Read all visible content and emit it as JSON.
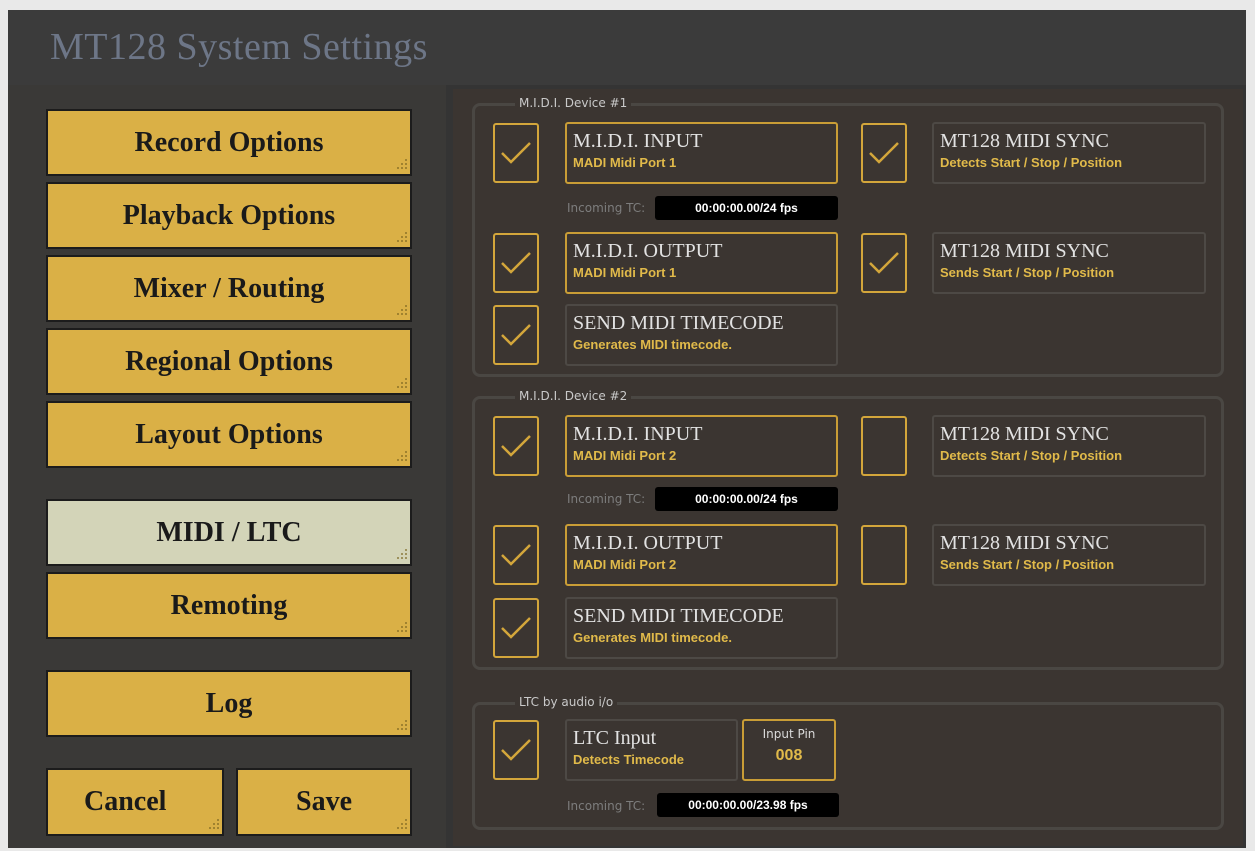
{
  "window": {
    "title": "MT128 System Settings"
  },
  "nav": {
    "items": [
      {
        "label": "Record Options",
        "active": false
      },
      {
        "label": "Playback Options",
        "active": false
      },
      {
        "label": "Mixer / Routing",
        "active": false
      },
      {
        "label": "Regional Options",
        "active": false
      },
      {
        "label": "Layout Options",
        "active": false
      },
      {
        "label": "MIDI / LTC",
        "active": true
      },
      {
        "label": "Remoting",
        "active": false
      },
      {
        "label": "Log",
        "active": false
      }
    ],
    "cancel_label": "Cancel",
    "save_label": "Save"
  },
  "device1": {
    "legend": "M.I.D.I. Device #1",
    "input": {
      "title": "M.I.D.I. INPUT",
      "subtitle": "MADI Midi Port 1",
      "checked": true
    },
    "input_sync": {
      "title": "MT128 MIDI SYNC",
      "subtitle": "Detects Start / Stop / Position",
      "checked": true
    },
    "incoming_tc_label": "Incoming TC:",
    "incoming_tc": "00:00:00.00/24 fps",
    "output": {
      "title": "M.I.D.I. OUTPUT",
      "subtitle": "MADI Midi Port 1",
      "checked": true
    },
    "output_sync": {
      "title": "MT128 MIDI SYNC",
      "subtitle": "Sends Start / Stop / Position",
      "checked": true
    },
    "send_tc": {
      "title": "SEND MIDI TIMECODE",
      "subtitle": "Generates MIDI timecode.",
      "checked": true
    }
  },
  "device2": {
    "legend": "M.I.D.I. Device #2",
    "input": {
      "title": "M.I.D.I. INPUT",
      "subtitle": "MADI Midi Port 2",
      "checked": true
    },
    "input_sync": {
      "title": "MT128 MIDI SYNC",
      "subtitle": "Detects Start / Stop / Position",
      "checked": false
    },
    "incoming_tc_label": "Incoming TC:",
    "incoming_tc": "00:00:00.00/24 fps",
    "output": {
      "title": "M.I.D.I. OUTPUT",
      "subtitle": "MADI Midi Port 2",
      "checked": true
    },
    "output_sync": {
      "title": "MT128 MIDI SYNC",
      "subtitle": "Sends Start / Stop / Position",
      "checked": false
    },
    "send_tc": {
      "title": "SEND MIDI TIMECODE",
      "subtitle": "Generates MIDI timecode.",
      "checked": true
    }
  },
  "ltc": {
    "legend": "LTC by audio i/o",
    "input": {
      "title": "LTC Input",
      "subtitle": "Detects Timecode",
      "checked": true
    },
    "pin_label": "Input Pin",
    "pin_value": "008",
    "incoming_tc_label": "Incoming TC:",
    "incoming_tc": "00:00:00.00/23.98 fps"
  },
  "colors": {
    "accent": "#dab046",
    "active_nav": "#d3d4b8",
    "check": "#d3a63b",
    "subtitle": "#e1ba4a"
  }
}
